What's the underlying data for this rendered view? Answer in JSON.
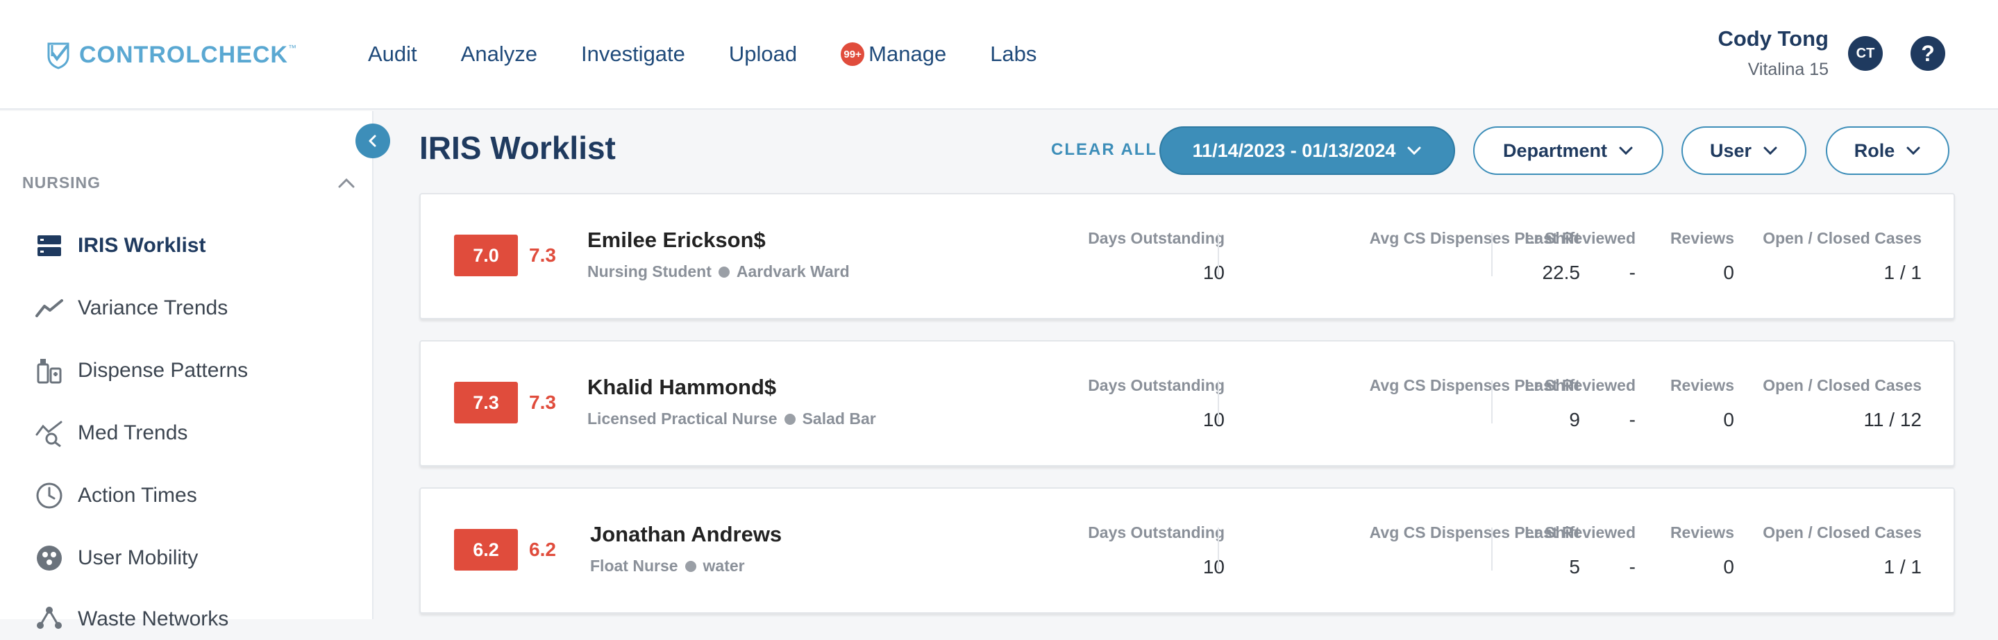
{
  "brand": {
    "part1": "CONTROL",
    "part2": "CHECK",
    "tm": "™"
  },
  "nav": [
    {
      "label": "Audit"
    },
    {
      "label": "Analyze"
    },
    {
      "label": "Investigate"
    },
    {
      "label": "Upload"
    },
    {
      "label": "Manage",
      "badge": "99+"
    },
    {
      "label": "Labs"
    }
  ],
  "user": {
    "name": "Cody Tong",
    "facility": "Vitalina 15",
    "initials": "CT",
    "help": "?"
  },
  "sidebar": {
    "section": "NURSING",
    "items": [
      {
        "label": "IRIS Worklist",
        "icon": "worklist-icon",
        "active": true
      },
      {
        "label": "Variance Trends",
        "icon": "trend-line-icon"
      },
      {
        "label": "Dispense Patterns",
        "icon": "dispense-icon"
      },
      {
        "label": "Med Trends",
        "icon": "med-trend-search-icon"
      },
      {
        "label": "Action Times",
        "icon": "clock-icon"
      },
      {
        "label": "User Mobility",
        "icon": "user-mobility-icon"
      },
      {
        "label": "Waste Networks",
        "icon": "network-icon"
      }
    ]
  },
  "main": {
    "title": "IRIS Worklist",
    "clear_all": "CLEAR ALL",
    "filters": {
      "date_range": "11/14/2023 - 01/13/2024",
      "department": "Department",
      "user": "User",
      "role": "Role"
    },
    "columns": {
      "days": "Days Outstanding",
      "avg": "Avg CS Dispenses Per Shift",
      "last": "Last Reviewed",
      "reviews": "Reviews",
      "cases": "Open / Closed Cases"
    },
    "rows": [
      {
        "score": "7.0",
        "score2": "7.3",
        "name": "Emilee Erickson$",
        "role": "Nursing Student",
        "unit": "Aardvark Ward",
        "days": "10",
        "avg": "22.5",
        "last": "-",
        "reviews": "0",
        "cases": "1 / 1"
      },
      {
        "score": "7.3",
        "score2": "7.3",
        "name": "Khalid Hammond$",
        "role": "Licensed Practical Nurse",
        "unit": "Salad Bar",
        "days": "10",
        "avg": "9",
        "last": "-",
        "reviews": "0",
        "cases": "11 / 12"
      },
      {
        "score": "6.2",
        "score2": "6.2",
        "name": "Jonathan Andrews",
        "role": "Float Nurse",
        "unit": "water",
        "days": "10",
        "avg": "5",
        "last": "-",
        "reviews": "0",
        "cases": "1 / 1"
      }
    ]
  },
  "colors": {
    "accent": "#3d8eb9",
    "navy": "#1f3a5f",
    "alert": "#e04c3c"
  }
}
